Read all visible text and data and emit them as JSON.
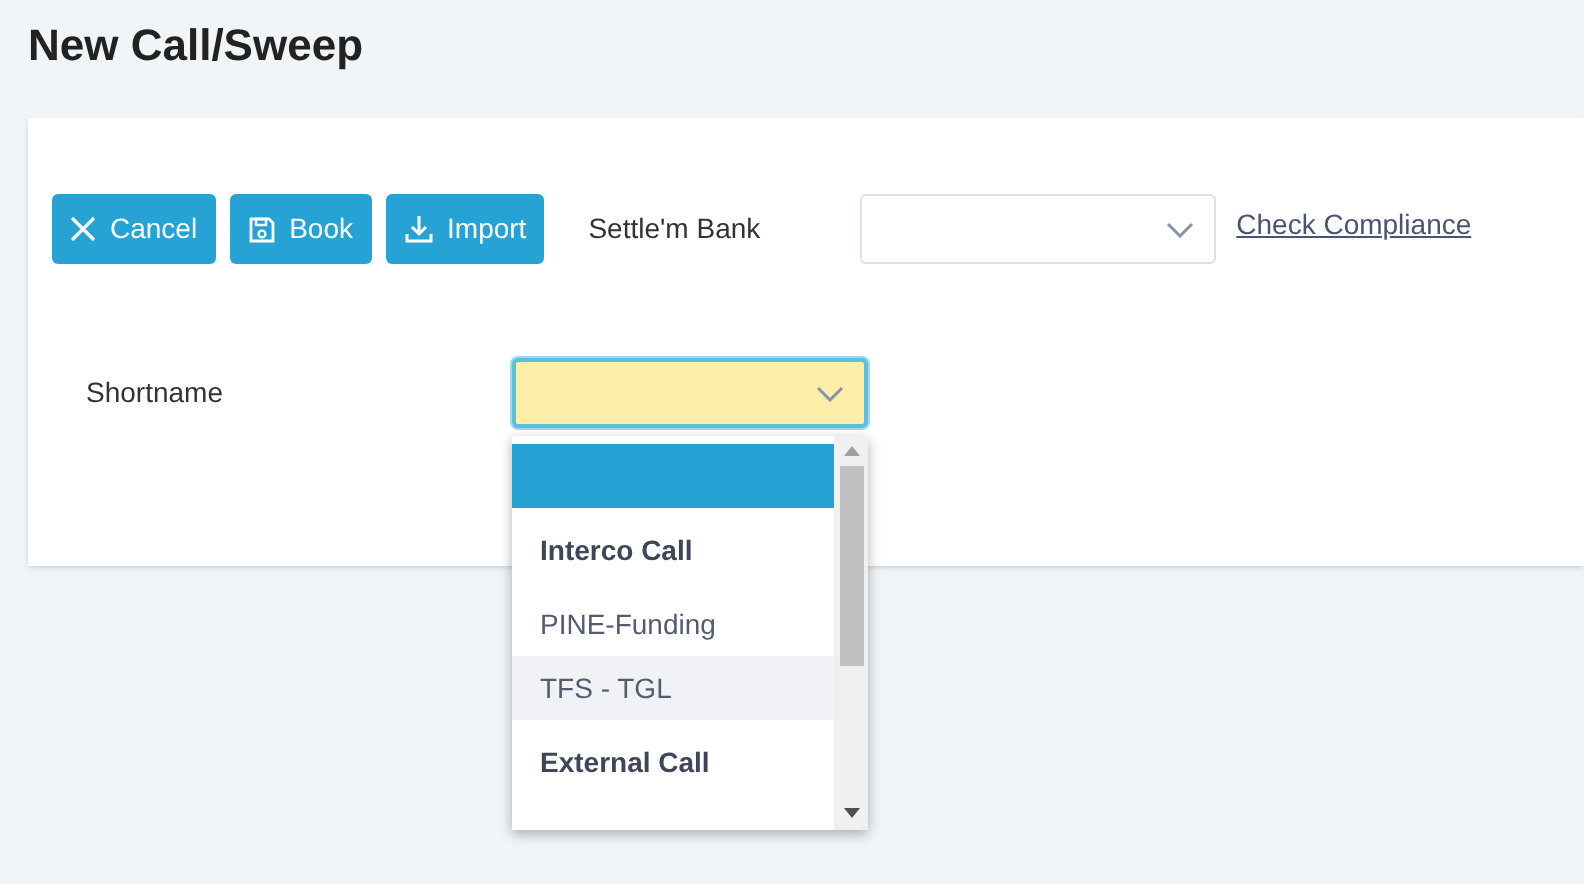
{
  "page_title": "New Call/Sweep",
  "toolbar": {
    "buttons": [
      {
        "label": "Cancel"
      },
      {
        "label": "Book"
      },
      {
        "label": "Import"
      }
    ],
    "settle_bank": {
      "label": "Settle'm Bank"
    },
    "link": "Check Compliance"
  },
  "shortname": {
    "label": "Shortname",
    "focused": true,
    "expanded": true,
    "options": [
      {
        "kind": "option",
        "selected": true
      },
      {
        "kind": "group",
        "label": "Interco Call"
      },
      {
        "kind": "option",
        "label": "PINE-Funding",
        "selected": false,
        "hovered": false
      },
      {
        "kind": "option",
        "label": "TFS - TGL",
        "selected": false,
        "hovered": true
      },
      {
        "kind": "group",
        "label": "External Call"
      }
    ]
  }
}
